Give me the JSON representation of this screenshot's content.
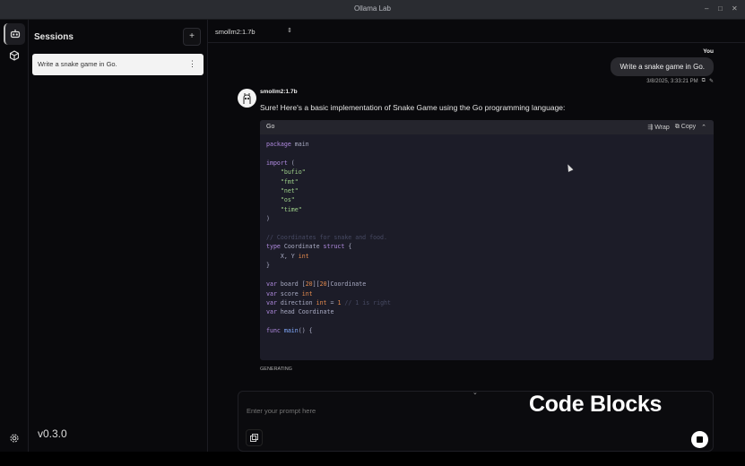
{
  "window": {
    "title": "Ollama Lab"
  },
  "sidebar": {
    "title": "Sessions",
    "new_session": "+",
    "sessions": [
      {
        "title": "Write a snake game in Go.",
        "menu": "⋮"
      }
    ],
    "version": "v0.3.0"
  },
  "header": {
    "model": "smollm2:1.7b",
    "chevron": "⌃⌄"
  },
  "chat": {
    "user": {
      "label": "You",
      "text": "Write a snake game in Go.",
      "timestamp": "3/8/2025, 3:33:21 PM"
    },
    "bot": {
      "name": "smollm2:1.7b",
      "text": "Sure! Here's a basic implementation of Snake Game using the Go programming language:",
      "code": {
        "language": "Go",
        "wrap": "Wrap",
        "copy": "Copy",
        "lines": [
          [
            [
              "kw",
              "package"
            ],
            [
              "pl",
              " main"
            ]
          ],
          [],
          [
            [
              "kw",
              "import"
            ],
            [
              "pl",
              " ("
            ]
          ],
          [
            [
              "pl",
              "    "
            ],
            [
              "st",
              "\"bufio\""
            ]
          ],
          [
            [
              "pl",
              "    "
            ],
            [
              "st",
              "\"fmt\""
            ]
          ],
          [
            [
              "pl",
              "    "
            ],
            [
              "st",
              "\"net\""
            ]
          ],
          [
            [
              "pl",
              "    "
            ],
            [
              "st",
              "\"os\""
            ]
          ],
          [
            [
              "pl",
              "    "
            ],
            [
              "st",
              "\"time\""
            ]
          ],
          [
            [
              "pl",
              ")"
            ]
          ],
          [],
          [
            [
              "cm",
              "// Coordinates for snake and food."
            ]
          ],
          [
            [
              "kw",
              "type"
            ],
            [
              "pl",
              " Coordinate "
            ],
            [
              "kw",
              "struct"
            ],
            [
              "pl",
              " {"
            ]
          ],
          [
            [
              "pl",
              "    X, Y "
            ],
            [
              "nu",
              "int"
            ]
          ],
          [
            [
              "pl",
              "}"
            ]
          ],
          [],
          [
            [
              "kw",
              "var"
            ],
            [
              "pl",
              " board ["
            ],
            [
              "nu",
              "20"
            ],
            [
              "pl",
              "]["
            ],
            [
              "nu",
              "20"
            ],
            [
              "pl",
              "]Coordinate"
            ]
          ],
          [
            [
              "kw",
              "var"
            ],
            [
              "pl",
              " score "
            ],
            [
              "nu",
              "int"
            ]
          ],
          [
            [
              "kw",
              "var"
            ],
            [
              "pl",
              " direction "
            ],
            [
              "nu",
              "int"
            ],
            [
              "pl",
              " = "
            ],
            [
              "nu",
              "1"
            ],
            [
              "cm",
              " // 1 is right"
            ]
          ],
          [
            [
              "kw",
              "var"
            ],
            [
              "pl",
              " head Coordinate"
            ]
          ],
          [],
          [
            [
              "kw",
              "func"
            ],
            [
              "fn",
              " main"
            ],
            [
              "pl",
              "() {"
            ]
          ]
        ]
      },
      "status": "GENERATING"
    }
  },
  "input": {
    "placeholder": "Enter your prompt here"
  },
  "overlay": {
    "caption": "Code Blocks"
  }
}
